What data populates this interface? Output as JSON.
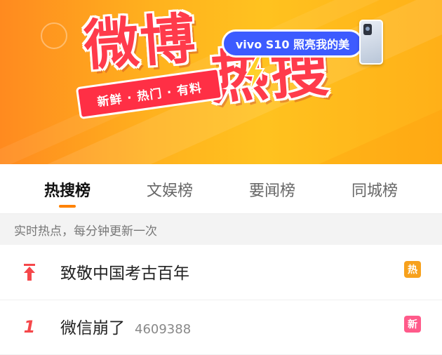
{
  "banner": {
    "logo_weibo": "微博",
    "logo_hot": "热搜",
    "tagline": "新鲜 · 热门 · 有料",
    "ad_text": "vivo S10 照亮我的美",
    "colors": {
      "brand_red": "#ff3b4b",
      "ad_blue": "#3d5bff",
      "banner_orange": "#ffb21e"
    }
  },
  "tabs": [
    {
      "label": "热搜榜",
      "active": true
    },
    {
      "label": "文娱榜",
      "active": false
    },
    {
      "label": "要闻榜",
      "active": false
    },
    {
      "label": "同城榜",
      "active": false
    }
  ],
  "hint": "实时热点，每分钟更新一次",
  "list": [
    {
      "rank_icon": "pin-top-icon",
      "title": "致敬中国考古百年",
      "count": "",
      "badge": {
        "text": "热",
        "color": "#f7a11c"
      }
    },
    {
      "rank": "1",
      "title": "微信崩了",
      "count": "4609388",
      "badge": {
        "text": "新",
        "color": "#ff5a8a"
      }
    }
  ],
  "colors": {
    "accent": "#ff8200",
    "rank_red": "#f5474a"
  }
}
